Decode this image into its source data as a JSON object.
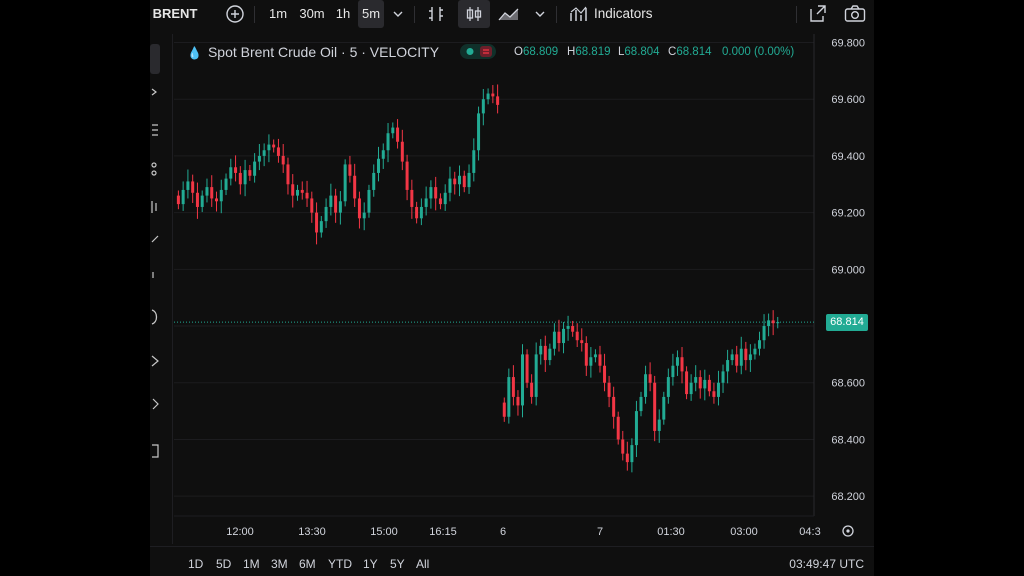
{
  "toolbar": {
    "symbol": "BRENT",
    "timeframes": [
      "1m",
      "30m",
      "1h",
      "5m"
    ],
    "active_timeframe": "5m",
    "indicators_label": "Indicators",
    "icons": [
      "add-symbol-icon",
      "chevron-down-icon",
      "compare-icon",
      "candles-icon",
      "area-chart-icon",
      "chevron-down-icon",
      "indicators-icon",
      "fullscreen-icon",
      "camera-icon"
    ]
  },
  "legend": {
    "title": "Spot Brent Crude Oil · 5 · VELOCITY",
    "open_label": "O",
    "open": "68.809",
    "high_label": "H",
    "high": "68.819",
    "low_label": "L",
    "low": "68.804",
    "close_label": "C",
    "close": "68.814",
    "change": "0.000 (0.00%)"
  },
  "price_axis": {
    "current_price": "68.814",
    "current_value": 68.814
  },
  "ranges": {
    "items": [
      "1D",
      "5D",
      "1M",
      "3M",
      "6M",
      "YTD",
      "1Y",
      "5Y",
      "All"
    ],
    "clock": "03:49:47 UTC"
  },
  "colors": {
    "up": "#22ab94",
    "down": "#f23645",
    "background": "#0f0f0f",
    "grid": "#1c1c1f",
    "axis_text": "#d1d4dc"
  },
  "chart_data": {
    "type": "candlestick",
    "title": "Spot Brent Crude Oil · 5 · VELOCITY",
    "ylim": [
      68.13,
      69.83
    ],
    "y_ticks": [
      69.8,
      69.6,
      69.4,
      69.2,
      69.0,
      68.8,
      68.6,
      68.4,
      68.2
    ],
    "y_tick_labels": [
      "69.800",
      "69.600",
      "69.400",
      "69.200",
      "69.000",
      "68.800",
      "68.600",
      "68.400",
      "68.200"
    ],
    "x_tick_labels": [
      "12:00",
      "13:30",
      "15:00",
      "16:15",
      "6",
      "7",
      "01:30",
      "03:00",
      "04:3"
    ],
    "series": [
      {
        "segment": "session-1",
        "closes": [
          69.23,
          69.28,
          69.31,
          69.27,
          69.22,
          69.26,
          69.29,
          69.25,
          69.24,
          69.28,
          69.32,
          69.36,
          69.34,
          69.3,
          69.35,
          69.33,
          69.38,
          69.4,
          69.42,
          69.44,
          69.43,
          69.4,
          69.37,
          69.3,
          69.26,
          69.28,
          69.27,
          69.25,
          69.2,
          69.13,
          69.17,
          69.22,
          69.26,
          69.2,
          69.24,
          69.37,
          69.33,
          69.25,
          69.18,
          69.2,
          69.28,
          69.34,
          69.39,
          69.42,
          69.48,
          69.5,
          69.45,
          69.38,
          69.28,
          69.22,
          69.18,
          69.22,
          69.25,
          69.29,
          69.25,
          69.23,
          69.27,
          69.32,
          69.3,
          69.33,
          69.29,
          69.34,
          69.42,
          69.55,
          69.6,
          69.62,
          69.61,
          69.58
        ],
        "candles": 68
      },
      {
        "segment": "session-2",
        "closes": [
          68.48,
          68.62,
          68.55,
          68.52,
          68.7,
          68.6,
          68.55,
          68.7,
          68.73,
          68.68,
          68.72,
          68.78,
          68.74,
          68.79,
          68.8,
          68.78,
          68.75,
          68.74,
          68.66,
          68.69,
          68.7,
          68.66,
          68.6,
          68.55,
          68.48,
          68.4,
          68.35,
          68.32,
          68.38,
          68.5,
          68.55,
          68.63,
          68.6,
          68.43,
          68.47,
          68.55,
          68.62,
          68.66,
          68.69,
          68.64,
          68.56,
          68.6,
          68.62,
          68.58,
          68.61,
          68.57,
          68.55,
          68.6,
          68.64,
          68.68,
          68.7,
          68.66,
          68.72,
          68.68,
          68.7,
          68.72,
          68.75,
          68.8,
          68.82,
          68.81,
          68.814
        ],
        "candles": 61
      }
    ],
    "current_price": 68.814,
    "grid": true
  }
}
